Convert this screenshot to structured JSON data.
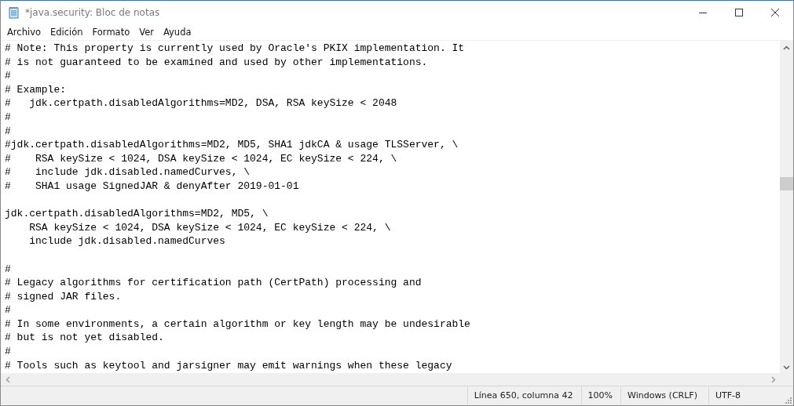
{
  "window": {
    "title": "*java.security: Bloc de notas"
  },
  "menu": [
    "Archivo",
    "Edición",
    "Formato",
    "Ver",
    "Ayuda"
  ],
  "editor": {
    "blocks": [
      [
        "# Note: This property is currently used by Oracle's PKIX implementation. It",
        "# is not guaranteed to be examined and used by other implementations.",
        "#",
        "# Example:",
        "#   jdk.certpath.disabledAlgorithms=MD2, DSA, RSA keySize < 2048",
        "#",
        "#",
        "#jdk.certpath.disabledAlgorithms=MD2, MD5, SHA1 jdkCA & usage TLSServer, \\",
        "#    RSA keySize < 1024, DSA keySize < 1024, EC keySize < 224, \\",
        "#    include jdk.disabled.namedCurves, \\",
        "#    SHA1 usage SignedJAR & denyAfter 2019-01-01"
      ],
      [
        "jdk.certpath.disabledAlgorithms=MD2, MD5, \\",
        "    RSA keySize < 1024, DSA keySize < 1024, EC keySize < 224, \\",
        "    include jdk.disabled.namedCurves"
      ],
      [
        "#",
        "# Legacy algorithms for certification path (CertPath) processing and",
        "# signed JAR files.",
        "#",
        "# In some environments, a certain algorithm or key length may be undesirable",
        "# but is not yet disabled.",
        "#",
        "# Tools such as keytool and jarsigner may emit warnings when these legacy"
      ]
    ]
  },
  "status_bar": [
    "Línea 650, columna 42",
    "100%",
    "Windows (CRLF)",
    "UTF-8"
  ]
}
